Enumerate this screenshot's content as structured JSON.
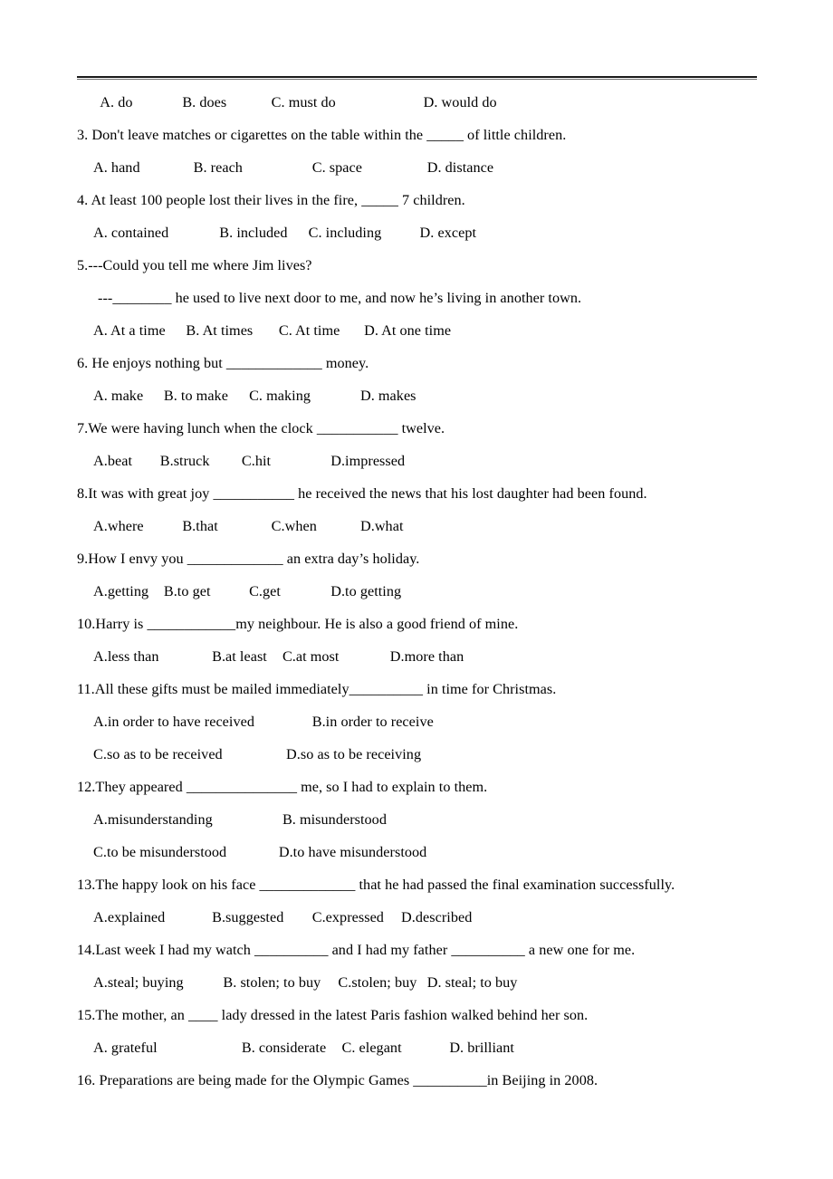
{
  "document": {
    "background_color": "#ffffff",
    "text_color": "#000000",
    "header_rule_color": "#1a1a1a",
    "lines": [
      {
        "id": "q2_options",
        "kind": "options",
        "text": "  A. do\t\tB. does\t\tC. must do\t\t\t D. would do"
      },
      {
        "id": "q3_stem",
        "kind": "stem",
        "text": "3. Don't leave matches or cigarettes on the table within the _____ of little children."
      },
      {
        "id": "q3_options",
        "kind": "options",
        "text": "A. hand\t\t   B. reach\t\t   C. space\t\t  D. distance"
      },
      {
        "id": "q4_stem",
        "kind": "stem",
        "text": "4. At least 100 people lost their lives in the fire, _____ 7 children."
      },
      {
        "id": "q4_options",
        "kind": "options",
        "text": "A. contained\t\t  B. included\t  C. including\t\tD. except"
      },
      {
        "id": "q5_stem",
        "kind": "stem",
        "text": "5.---Could you tell me where Jim lives?"
      },
      {
        "id": "q5_continuation",
        "kind": "continuation",
        "text": "---________ he used to live next door to me, and now he’s living in another town."
      },
      {
        "id": "q5_options",
        "kind": "options",
        "text": "A. At a time\t B. At times\t  C. At time\t D. At one time"
      },
      {
        "id": "q6_stem",
        "kind": "stem",
        "text": "6. He enjoys nothing but _____________ money."
      },
      {
        "id": "q6_options",
        "kind": "options",
        "text": "A. make\t   B. to make\t  C. making\t\tD. makes"
      },
      {
        "id": "q7_stem",
        "kind": "stem",
        "text": "7.We were having lunch when the clock ___________ twelve."
      },
      {
        "id": "q7_options",
        "kind": "options",
        "text": "A.beat\t  B.struck\t\tC.hit\t\tD.impressed"
      },
      {
        "id": "q8_stem",
        "kind": "stem",
        "text": "8.It was with great joy ___________ he received the news that his lost daughter had been found."
      },
      {
        "id": "q8_options",
        "kind": "options",
        "text": "A.where\t\tB.that\t\tC.when\t\tD.what"
      },
      {
        "id": "q9_stem",
        "kind": "stem",
        "text": "9.How I envy you _____________ an extra day’s holiday."
      },
      {
        "id": "q9_options",
        "kind": "options",
        "text": "A.getting\t   B.to get\t  C.get\t\tD.to getting"
      },
      {
        "id": "q10_stem",
        "kind": "stem",
        "text": "10.Harry is ____________my neighbour. He is also a good friend of mine."
      },
      {
        "id": "q10_options",
        "kind": "options",
        "text": "A.less than\t\tB.at least\t   C.at most\t\tD.more than"
      },
      {
        "id": "q11_stem",
        "kind": "stem",
        "text": "11.All these gifts must be mailed immediately__________ in time for Christmas."
      },
      {
        "id": "q11_options_ab",
        "kind": "options",
        "text": "A.in order to have received\t\t   B.in order to receive"
      },
      {
        "id": "q11_options_cd",
        "kind": "options",
        "text": "C.so as to be received\t\t    D.so as to be receiving"
      },
      {
        "id": "q12_stem",
        "kind": "stem",
        "text": "12.They appeared _______________ me, so I had to explain to them."
      },
      {
        "id": "q12_options_ab",
        "kind": "options",
        "text": "A.misunderstanding\t\t   B. misunderstood"
      },
      {
        "id": "q12_options_cd",
        "kind": "options",
        "text": "C.to be misunderstood\t\t  D.to have misunderstood"
      },
      {
        "id": "q13_stem",
        "kind": "stem",
        "text": "13.The happy look on his face _____________ that he had passed the final examination successfully."
      },
      {
        "id": "q13_options",
        "kind": "options",
        "text": "A.explained\t\tB.suggested\t   C.expressed\t   D.described"
      },
      {
        "id": "q14_stem",
        "kind": "stem",
        "text": "14.Last week I had my watch __________ and I had my father __________ a new one for me."
      },
      {
        "id": "q14_options",
        "kind": "options",
        "text": "A.steal; buying\t   B. stolen; to buy\t  C.stolen; buy\t  D. steal; to buy"
      },
      {
        "id": "q15_stem",
        "kind": "stem",
        "text": "15.The mother, an ____ lady dressed in the latest Paris fashion walked behind her son."
      },
      {
        "id": "q15_options",
        "kind": "options",
        "text": "A. grateful\t\t\tB. considerate\t   C. elegant\t\tD. brilliant"
      },
      {
        "id": "q16_stem",
        "kind": "stem",
        "text": "16. Preparations are being made for the Olympic Games __________in Beijing in 2008."
      }
    ]
  }
}
